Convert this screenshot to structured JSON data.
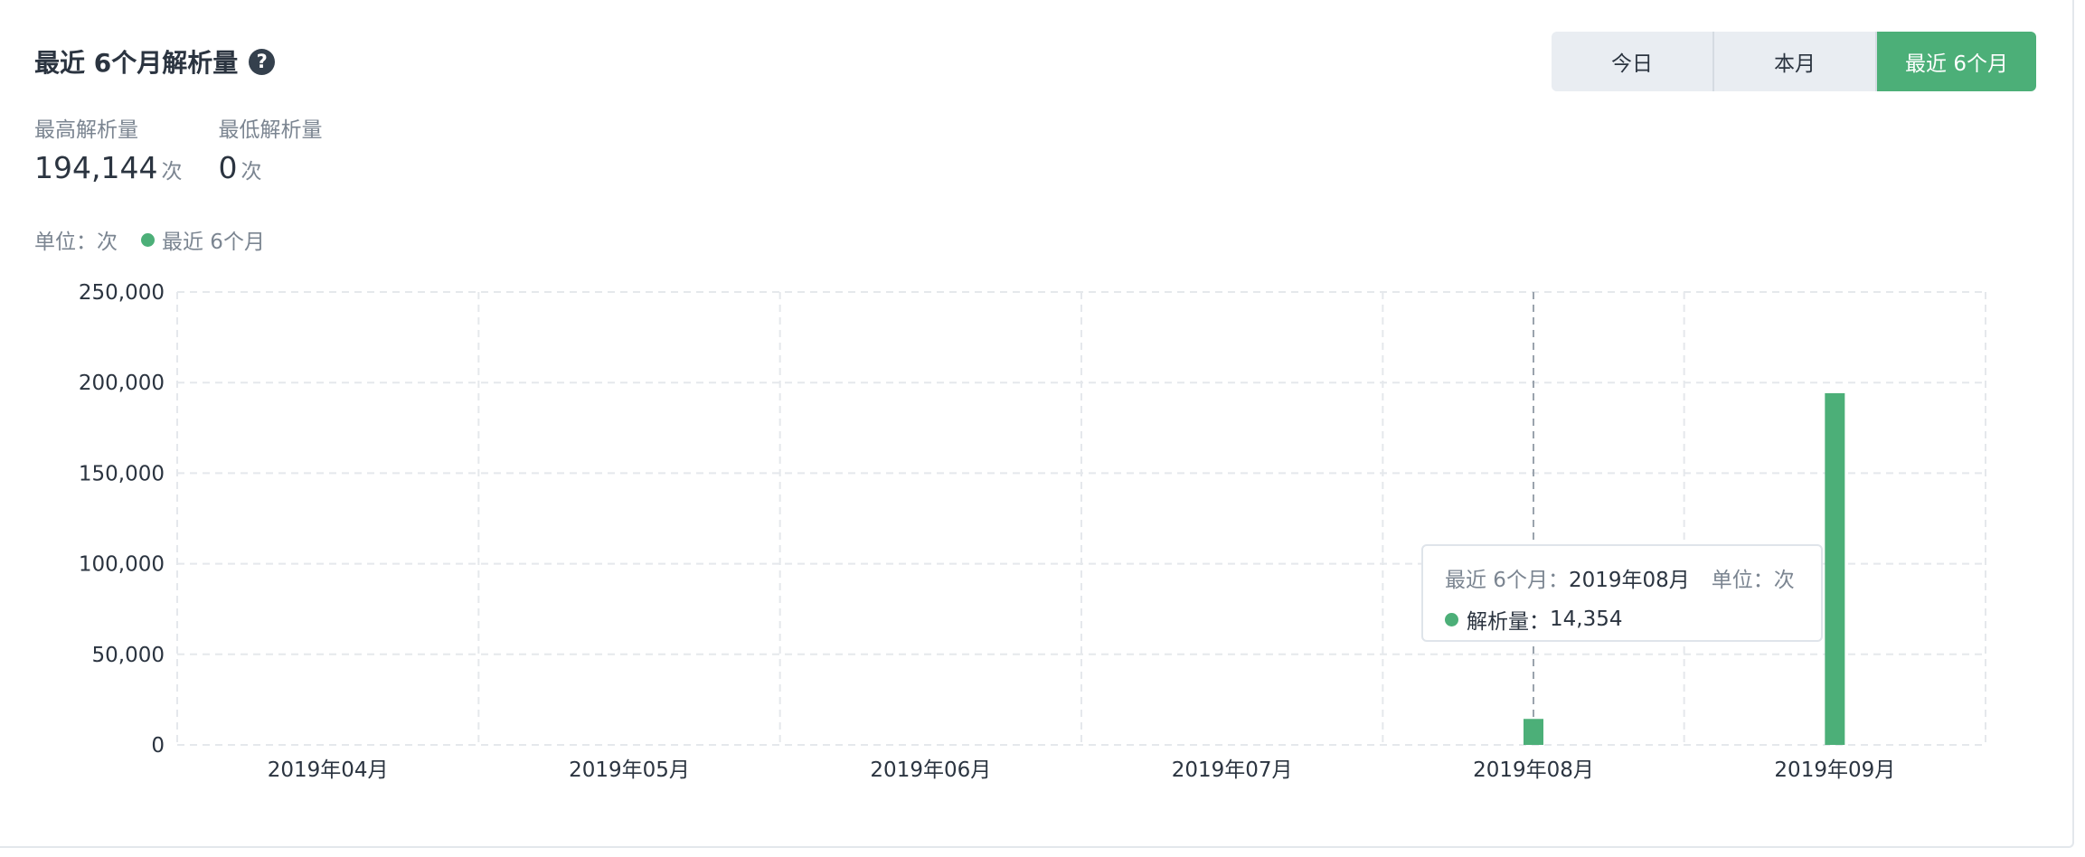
{
  "header": {
    "title": "最近 6个月解析量",
    "help_icon": "question-circle-icon"
  },
  "range_tabs": [
    {
      "label": "今日",
      "active": false
    },
    {
      "label": "本月",
      "active": false
    },
    {
      "label": "最近 6个月",
      "active": true
    }
  ],
  "stats": {
    "max_label": "最高解析量",
    "max_value": "194,144",
    "max_unit": "次",
    "min_label": "最低解析量",
    "min_value": "0",
    "min_unit": "次"
  },
  "legend": {
    "unit_text": "单位：次",
    "series_name": "最近 6个月"
  },
  "colors": {
    "accent": "#4caf78",
    "tab_bg": "#e9edf2",
    "grid": "#e5e8ec",
    "text_muted": "#7b8591"
  },
  "tooltip": {
    "series_label": "最近 6个月：",
    "period": "2019年08月",
    "unit_text": "单位：次",
    "metric_label": "解析量：",
    "metric_value": "14,354"
  },
  "chart_data": {
    "type": "bar",
    "categories": [
      "2019年04月",
      "2019年05月",
      "2019年06月",
      "2019年07月",
      "2019年08月",
      "2019年09月"
    ],
    "series": [
      {
        "name": "最近 6个月",
        "values": [
          0,
          0,
          0,
          0,
          14354,
          194144
        ]
      }
    ],
    "ylim": [
      0,
      250000
    ],
    "yticks": [
      0,
      50000,
      100000,
      150000,
      200000,
      250000
    ],
    "ytick_labels": [
      "0",
      "50,000",
      "100,000",
      "150,000",
      "200,000",
      "250,000"
    ],
    "grid": true,
    "highlighted_category": "2019年08月"
  }
}
